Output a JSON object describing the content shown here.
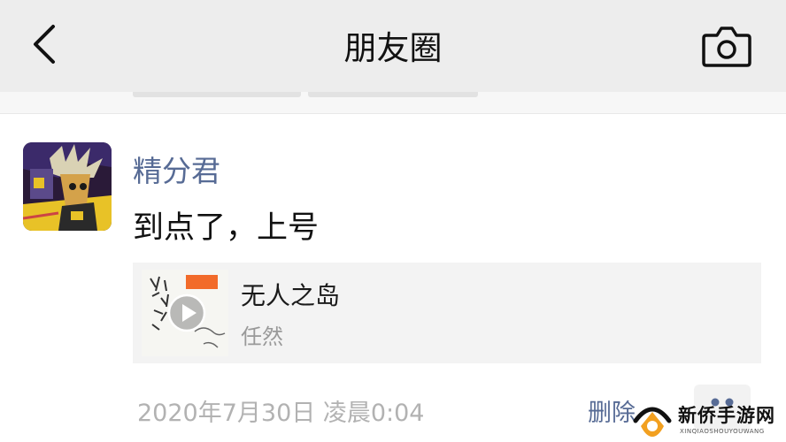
{
  "navbar": {
    "title": "朋友圈",
    "back_icon": "chevron-left-icon",
    "camera_icon": "camera-icon"
  },
  "post": {
    "nickname": "精分君",
    "text": "到点了，上号",
    "music": {
      "title": "无人之岛",
      "artist": "任然",
      "play_icon": "play-icon"
    },
    "timestamp": "2020年7月30日 凌晨0:04",
    "delete_label": "删除",
    "more_icon": "more-dots-icon"
  },
  "watermark": {
    "brand": "新侨手游网",
    "domain": "XINQIAOSHOUYOUWANG"
  },
  "colors": {
    "nav_background": "#ededed",
    "nickname": "#576b95",
    "delete_link": "#576b95",
    "timestamp": "#b2b2b2",
    "card_background": "#f3f3f3"
  }
}
